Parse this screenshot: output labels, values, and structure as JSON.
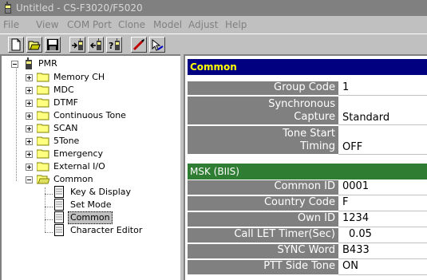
{
  "window": {
    "title": "Untitled - CS-F3020/F5020"
  },
  "menu": {
    "items": [
      "File",
      "View",
      "COM Port",
      "Clone",
      "Model",
      "Adjust",
      "Help"
    ]
  },
  "toolbar": {
    "icons": [
      "new-icon",
      "open-icon",
      "save-icon",
      "read-from-radio-icon",
      "write-to-radio-icon",
      "radio-info-icon",
      "edit-icon",
      "help-pointer-icon"
    ]
  },
  "tree": {
    "root": "PMR",
    "folders": [
      "Memory CH",
      "MDC",
      "DTMF",
      "Continuous Tone",
      "SCAN",
      "5Tone",
      "Emergency",
      "External I/O",
      "Common"
    ],
    "children": [
      "Key & Display",
      "Set Mode",
      "Common",
      "Character Editor"
    ],
    "selected": "Common"
  },
  "form": {
    "common_header": "Common",
    "group_code": {
      "label": "Group Code",
      "value": "1"
    },
    "sync_capture": {
      "label_line1": "Synchronous",
      "label_line2": "Capture",
      "value": "Standard"
    },
    "tone_start": {
      "label_line1": "Tone Start",
      "label_line2": "Timing",
      "value": "OFF"
    },
    "msk_header": "MSK (BIIS)",
    "common_id": {
      "label": "Common ID",
      "value": "0001"
    },
    "country_code": {
      "label": "Country Code",
      "value": "F"
    },
    "own_id": {
      "label": "Own ID",
      "value": "1234"
    },
    "call_let": {
      "label": "Call LET Timer(Sec)",
      "value": "0.05"
    },
    "sync_word": {
      "label": "SYNC Word",
      "value": "B433"
    },
    "ptt_side_tone": {
      "label": "PTT Side Tone",
      "value": "ON"
    }
  },
  "colors": {
    "common_header_bg": "#000080",
    "common_header_text": "#ffff00",
    "msk_header_bg": "#2e7d32",
    "label_bg": "#808080"
  }
}
